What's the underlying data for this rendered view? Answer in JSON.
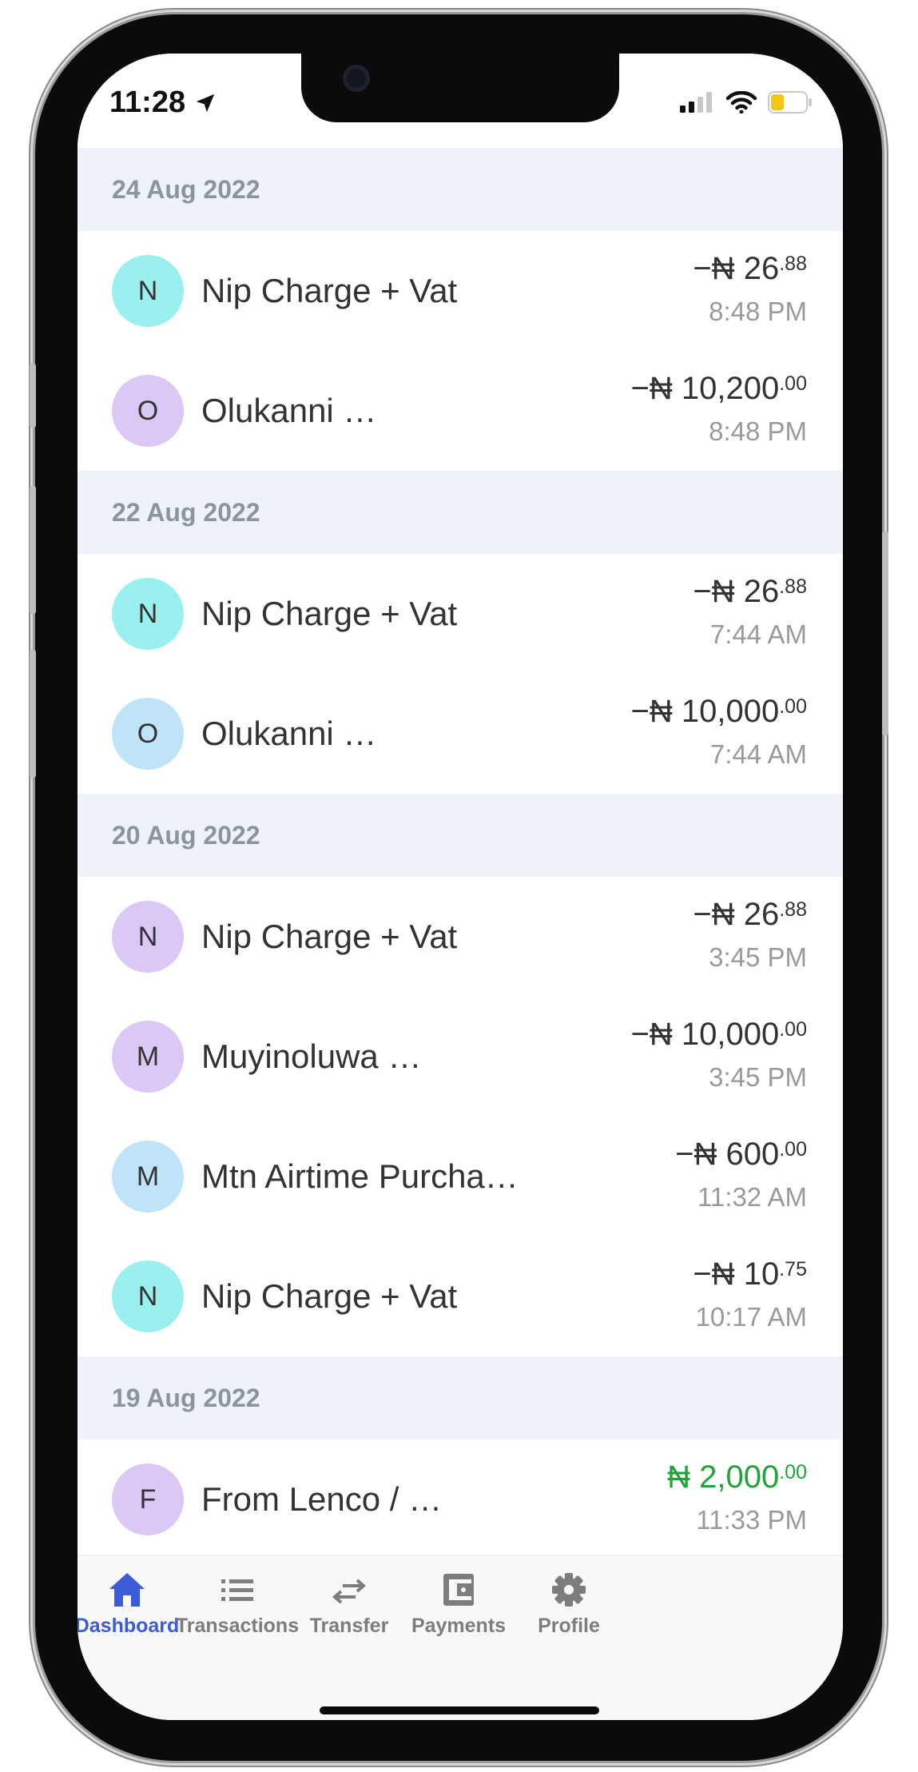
{
  "status_bar": {
    "time": "11:28"
  },
  "sections": [
    {
      "date": "24 Aug 2022",
      "items": [
        {
          "initial": "N",
          "name": "Nip Charge + Vat",
          "sign": "−",
          "currency": "₦",
          "whole": "26",
          "cents": ".88",
          "time": "8:48 PM",
          "avatar_color": "#9af0ee",
          "credit": false
        },
        {
          "initial": "O",
          "name": "Olukanni …",
          "sign": "−",
          "currency": "₦",
          "whole": "10,200",
          "cents": ".00",
          "time": "8:48 PM",
          "avatar_color": "#dcc8f7",
          "credit": false
        }
      ]
    },
    {
      "date": "22 Aug 2022",
      "items": [
        {
          "initial": "N",
          "name": "Nip Charge + Vat",
          "sign": "−",
          "currency": "₦",
          "whole": "26",
          "cents": ".88",
          "time": "7:44 AM",
          "avatar_color": "#9af0ee",
          "credit": false
        },
        {
          "initial": "O",
          "name": "Olukanni …",
          "sign": "−",
          "currency": "₦",
          "whole": "10,000",
          "cents": ".00",
          "time": "7:44 AM",
          "avatar_color": "#bfe4f7",
          "credit": false
        }
      ]
    },
    {
      "date": "20 Aug 2022",
      "items": [
        {
          "initial": "N",
          "name": "Nip Charge + Vat",
          "sign": "−",
          "currency": "₦",
          "whole": "26",
          "cents": ".88",
          "time": "3:45 PM",
          "avatar_color": "#dcc8f7",
          "credit": false
        },
        {
          "initial": "M",
          "name": "Muyinoluwa …",
          "sign": "−",
          "currency": "₦",
          "whole": "10,000",
          "cents": ".00",
          "time": "3:45 PM",
          "avatar_color": "#dcc8f7",
          "credit": false
        },
        {
          "initial": "M",
          "name": "Mtn Airtime Purcha…",
          "sign": "−",
          "currency": "₦",
          "whole": "600",
          "cents": ".00",
          "time": "11:32 AM",
          "avatar_color": "#bfe4f7",
          "credit": false
        },
        {
          "initial": "N",
          "name": "Nip Charge + Vat",
          "sign": "−",
          "currency": "₦",
          "whole": "10",
          "cents": ".75",
          "time": "10:17 AM",
          "avatar_color": "#9af0ee",
          "credit": false
        }
      ]
    },
    {
      "date": "19 Aug 2022",
      "items": [
        {
          "initial": "F",
          "name": "From Lenco / …",
          "sign": "",
          "currency": "₦",
          "whole": "2,000",
          "cents": ".00",
          "time": "11:33 PM",
          "avatar_color": "#dcc8f7",
          "credit": true
        }
      ]
    }
  ],
  "tabs": [
    {
      "label": "Dashboard",
      "icon": "home-icon",
      "active": true
    },
    {
      "label": "Transactions",
      "icon": "list-icon",
      "active": false
    },
    {
      "label": "Transfer",
      "icon": "transfer-icon",
      "active": false
    },
    {
      "label": "Payments",
      "icon": "wallet-icon",
      "active": false
    },
    {
      "label": "Profile",
      "icon": "gear-icon",
      "active": false
    }
  ],
  "colors": {
    "accent": "#3b5bdb",
    "credit": "#21a33a",
    "battery": "#f5c518"
  }
}
